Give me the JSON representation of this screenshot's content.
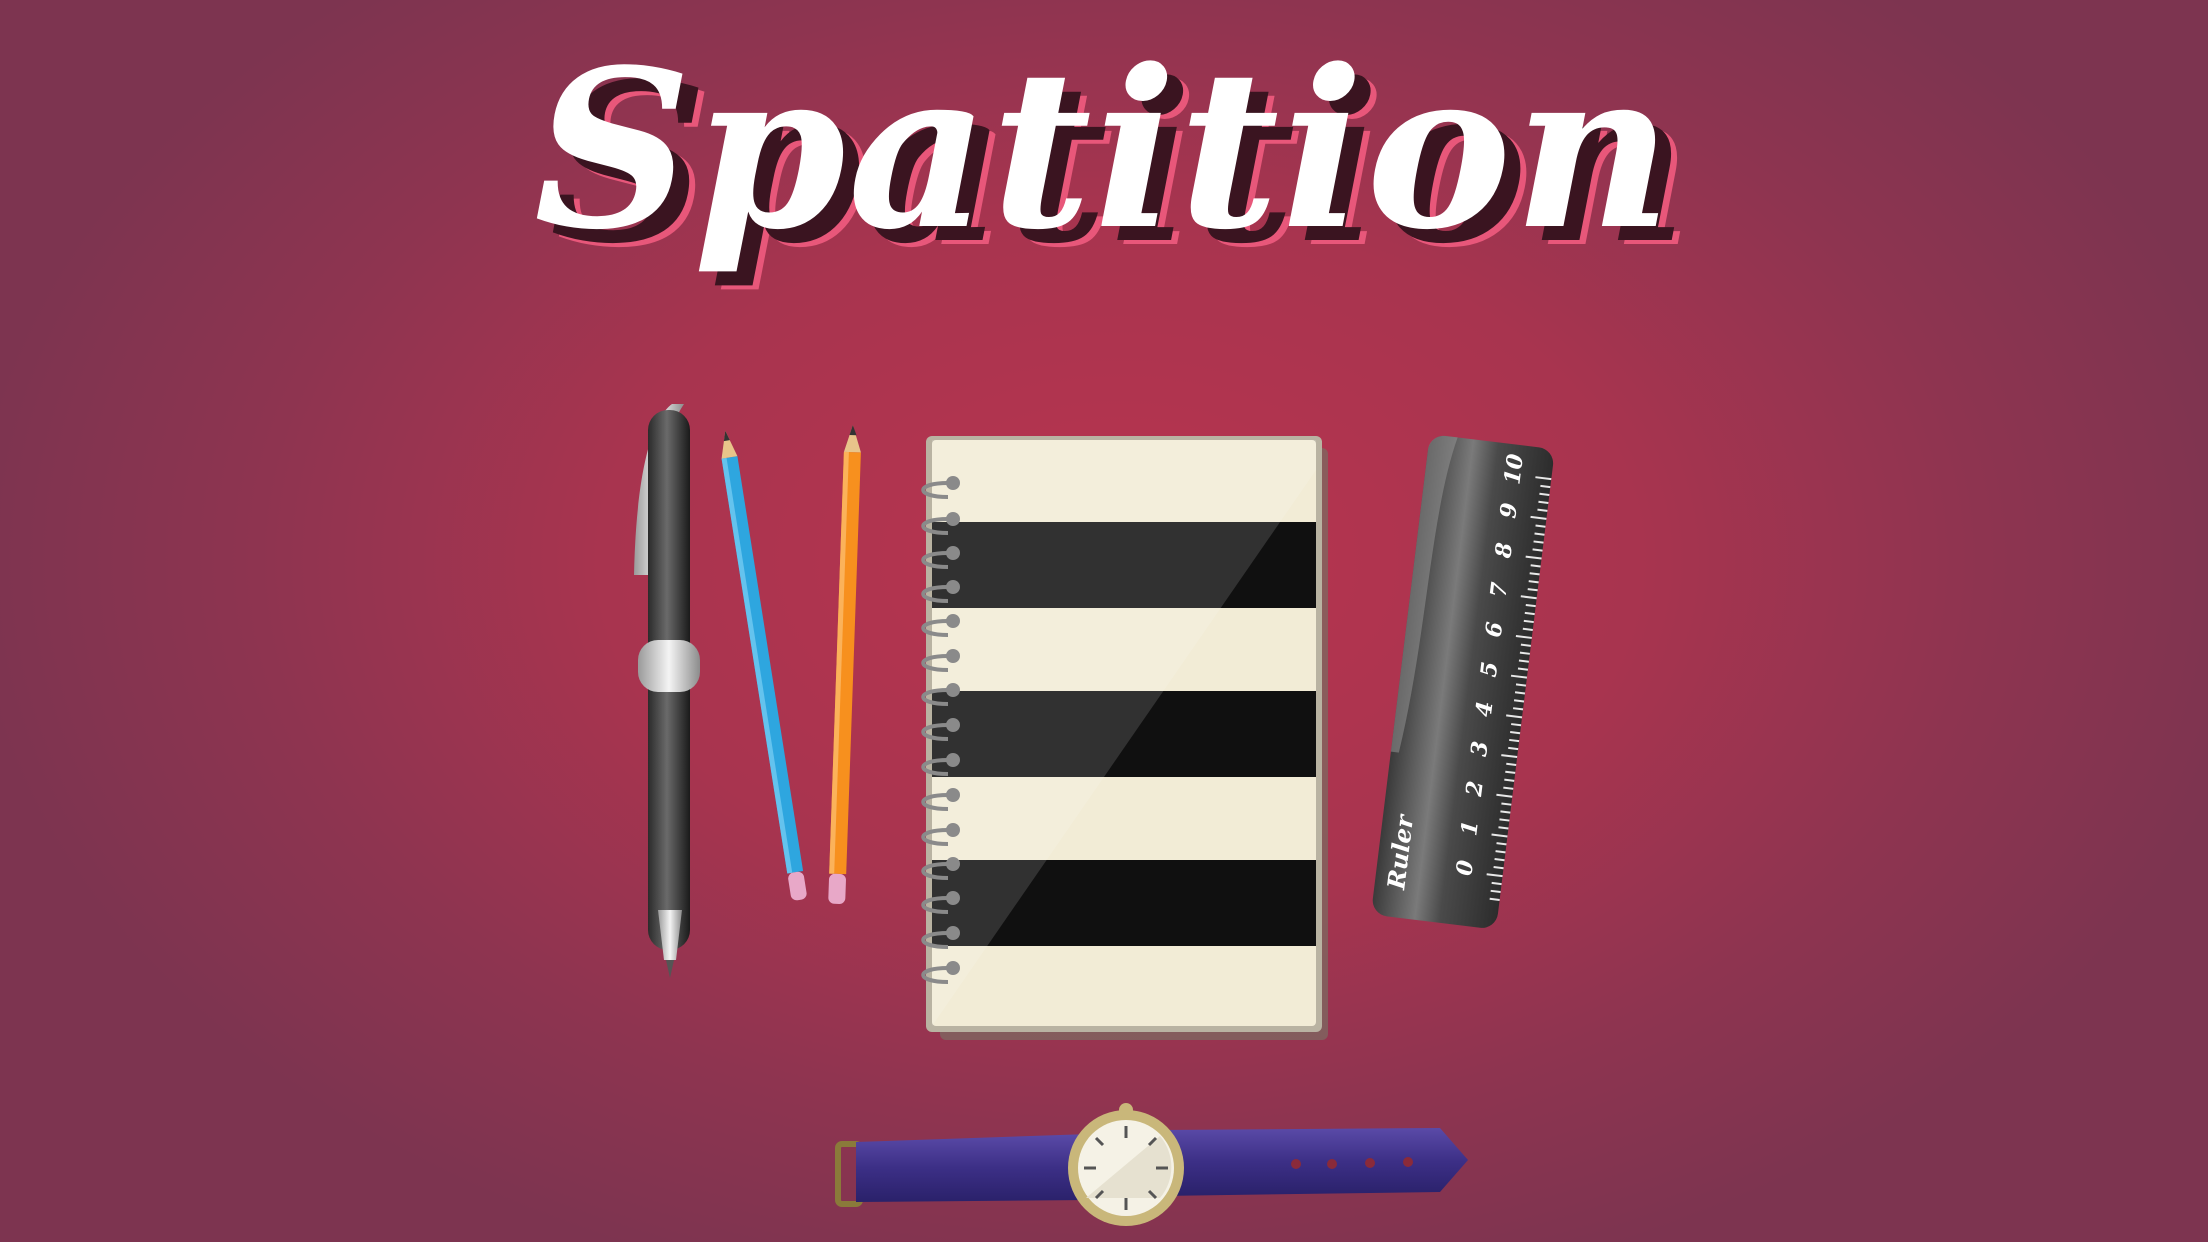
{
  "game": {
    "title": "Spatition"
  },
  "ruler": {
    "label": "Ruler",
    "numbers": [
      "0",
      "1",
      "2",
      "3",
      "4",
      "5",
      "6",
      "7",
      "8",
      "9",
      "10"
    ]
  },
  "notebook": {
    "pattern": [
      "light",
      "dark",
      "light",
      "dark",
      "light",
      "dark",
      "light"
    ]
  },
  "colors": {
    "background": "#a8344f",
    "paper": "#f2ecd6",
    "stripe_dark": "#101010",
    "blue_pencil": "#2ea6df",
    "orange_pencil": "#f7901e",
    "watch_strap": "#4a3a8c",
    "watch_case": "#c9b77a",
    "title_shadow": "#3a1420"
  },
  "icons": [
    "pen-icon",
    "blue-pencil-icon",
    "orange-pencil-icon",
    "notebook-icon",
    "ruler-icon",
    "wristwatch-icon"
  ]
}
